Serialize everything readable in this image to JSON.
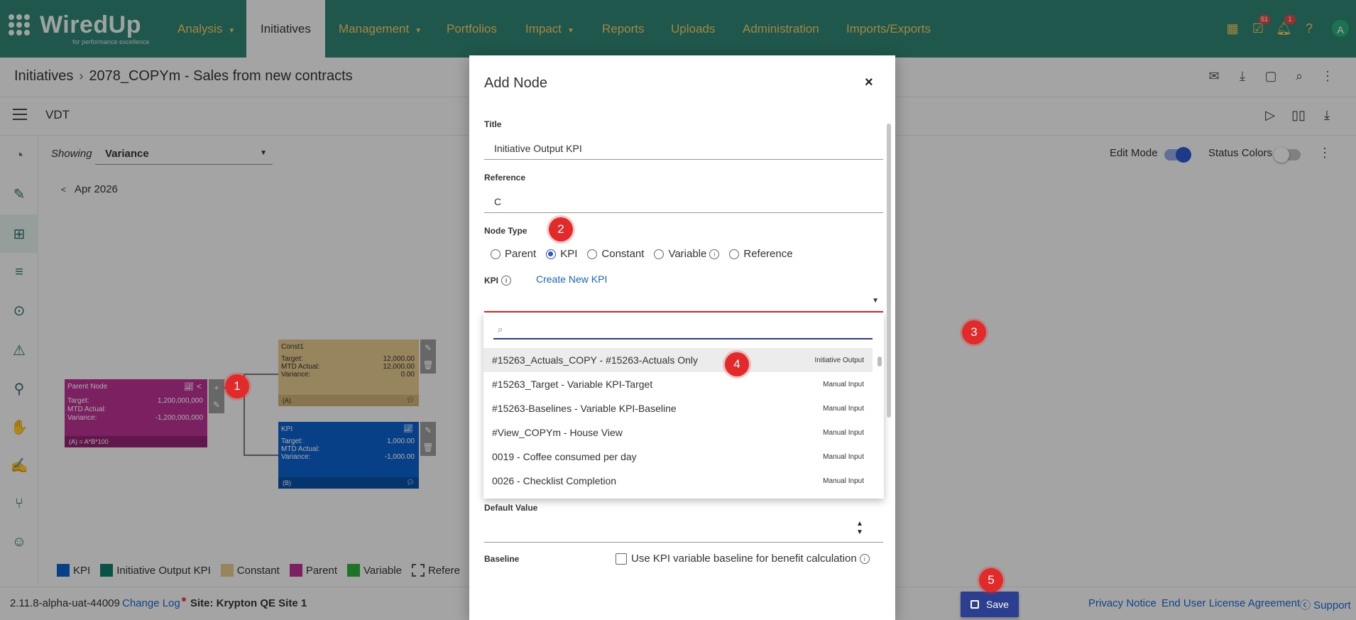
{
  "brand": {
    "name": "WiredUp",
    "tagline": "for performance excellence"
  },
  "nav": {
    "items": [
      {
        "label": "Analysis",
        "caret": true
      },
      {
        "label": "Initiatives",
        "caret": false,
        "active": true
      },
      {
        "label": "Management",
        "caret": true
      },
      {
        "label": "Portfolios",
        "caret": false
      },
      {
        "label": "Impact",
        "caret": true
      },
      {
        "label": "Reports",
        "caret": false
      },
      {
        "label": "Uploads",
        "caret": false
      },
      {
        "label": "Administration",
        "caret": false
      },
      {
        "label": "Imports/Exports",
        "caret": false
      }
    ],
    "badges": {
      "tasks": "51",
      "notifications": "1"
    },
    "avatar": "A",
    "caret_glyph": "▼"
  },
  "breadcrumb": {
    "root": "Initiatives",
    "separator": "›",
    "current": "2078_COPYm - Sales from new contracts"
  },
  "vdt": {
    "title": "VDT"
  },
  "canvas": {
    "showing_label": "Showing",
    "showing_value": "Variance",
    "period": "Apr 2026",
    "edit_mode_label": "Edit Mode",
    "edit_mode_on": true,
    "status_colors_label": "Status Colors",
    "status_colors_on": false
  },
  "nodes": {
    "parent": {
      "title": "Parent Node",
      "target_label": "Target:",
      "target": "1,200,000,000",
      "mtd_label": "MTD Actual:",
      "mtd": "",
      "variance_label": "Variance:",
      "variance": "-1,200,000,000",
      "formula": "(A) = A*B*100"
    },
    "const1": {
      "title": "Const1",
      "target_label": "Target:",
      "target": "12,000.00",
      "mtd_label": "MTD Actual:",
      "mtd": "12,000.00",
      "variance_label": "Variance:",
      "variance": "0.00",
      "ref": "(A)"
    },
    "kpi": {
      "title": "KPI",
      "target_label": "Target:",
      "target": "1,000.00",
      "mtd_label": "MTD Actual:",
      "mtd": "",
      "variance_label": "Variance:",
      "variance": "-1,000.00",
      "ref": "(B)"
    }
  },
  "legend": [
    {
      "label": "KPI",
      "color": "#0b5fc7"
    },
    {
      "label": "Initiative Output KPI",
      "color": "#0d7a6a"
    },
    {
      "label": "Constant",
      "color": "#dfc48a"
    },
    {
      "label": "Parent",
      "color": "#b5318f"
    },
    {
      "label": "Variable",
      "color": "#2eaa3c"
    },
    {
      "label": "Refere",
      "color": "dashed"
    }
  ],
  "footer": {
    "version": "2.11.8-alpha-uat-44009",
    "changelog": "Change Log",
    "site": "Site: Krypton QE Site 1",
    "privacy": "Privacy Notice",
    "eula": "End User License Agreement",
    "support": "Support"
  },
  "modal": {
    "title": "Add Node",
    "close": "×",
    "title_label": "Title",
    "title_value": "Initiative Output KPI",
    "reference_label": "Reference",
    "reference_value": "C",
    "node_type_label": "Node Type",
    "node_types": [
      "Parent",
      "KPI",
      "Constant",
      "Variable",
      "Reference"
    ],
    "node_type_selected": "KPI",
    "kpi_label": "KPI",
    "create_kpi": "Create New KPI",
    "search_value": "",
    "kpi_options": [
      {
        "name": "#15263_Actuals_COPY - #15263-Actuals Only",
        "type": "Initiative Output"
      },
      {
        "name": "#15263_Target - Variable KPI-Target",
        "type": "Manual Input"
      },
      {
        "name": "#15263-Baselines - Variable KPI-Baseline",
        "type": "Manual Input"
      },
      {
        "name": "#View_COPYm - House View",
        "type": "Manual Input"
      },
      {
        "name": "0019 - Coffee consumed per day",
        "type": "Manual Input"
      },
      {
        "name": "0026 - Checklist Completion",
        "type": "Manual Input"
      }
    ],
    "default_value_label": "Default Value",
    "baseline_label": "Baseline",
    "baseline_checkbox": "Use KPI variable baseline for benefit calculation",
    "save": "Save"
  },
  "steps": [
    "1",
    "2",
    "3",
    "4",
    "5"
  ],
  "colors": {
    "nav_bg": "#2f8070",
    "nav_text": "#f0c75e",
    "primary": "#2c3e8f",
    "link": "#1a66c9",
    "marker": "#e32a2a"
  }
}
